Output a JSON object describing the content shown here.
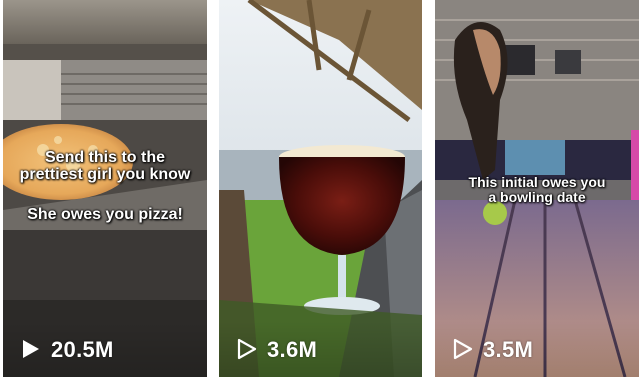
{
  "videos": [
    {
      "caption_lines": [
        "Send this to the",
        "prettiest girl you know",
        "She owes you pizza!"
      ],
      "views": "20.5M",
      "icon": "play-icon"
    },
    {
      "caption_lines": [],
      "views": "3.6M",
      "icon": "play-icon"
    },
    {
      "caption_lines": [
        "This initial owes you",
        "a bowling date"
      ],
      "views": "3.5M",
      "icon": "play-icon"
    }
  ]
}
